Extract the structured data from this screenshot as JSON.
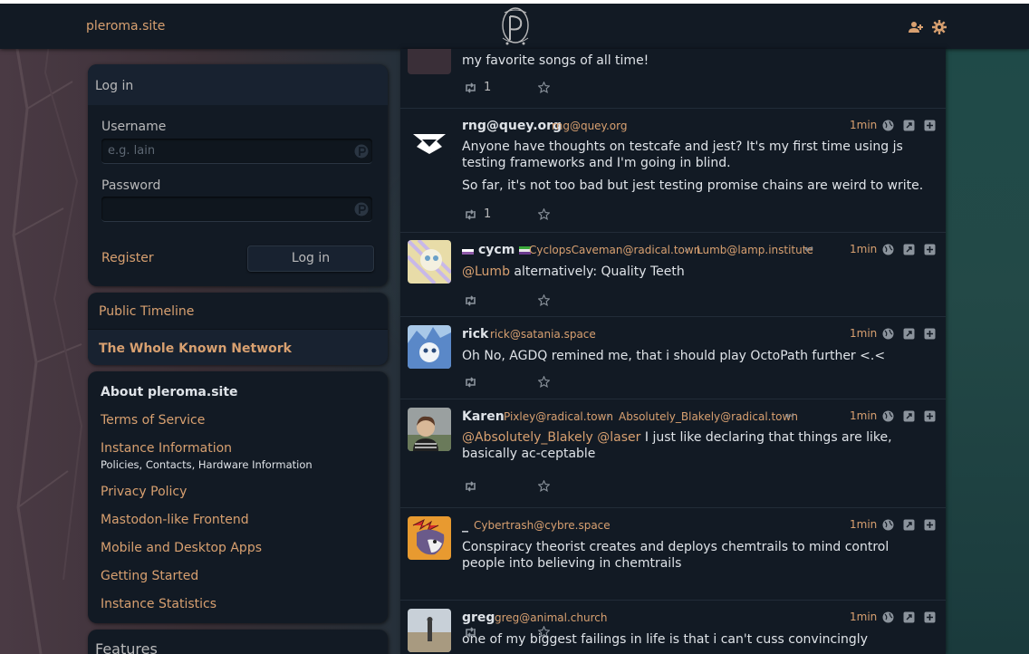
{
  "topbar": {
    "site_name": "pleroma.site",
    "logo_icon": "pleroma-logo",
    "icons": [
      "user-plus-icon",
      "gear-icon"
    ]
  },
  "colors": {
    "accent": "#d8a070",
    "panel": "#121a24",
    "text": "#b9b9ba",
    "link": "#d8a070"
  },
  "login": {
    "title": "Log in",
    "username_label": "Username",
    "username_placeholder": "e.g. lain",
    "password_label": "Password",
    "register_label": "Register",
    "login_button": "Log in"
  },
  "nav": {
    "items": [
      {
        "label": "Public Timeline"
      },
      {
        "label": "The Whole Known Network"
      }
    ]
  },
  "about": {
    "title": "About pleroma.site",
    "links": [
      {
        "label": "Terms of Service"
      },
      {
        "label": "Instance Information",
        "sub": "Policies, Contacts, Hardware Information"
      },
      {
        "label": "Privacy Policy"
      },
      {
        "label": "Mastodon-like Frontend"
      },
      {
        "label": "Mobile and Desktop Apps"
      },
      {
        "label": "Getting Started"
      },
      {
        "label": "Instance Statistics"
      }
    ]
  },
  "features": {
    "title": "Features"
  },
  "timeline": {
    "statuses": [
      {
        "content_tail": "my favorite songs of all time!",
        "retweets": "1"
      },
      {
        "name": "rng@quey.org",
        "handle": "rng@quey.org",
        "time": "1min",
        "content": [
          "Anyone have thoughts on testcafe and jest? It's my first time using js testing frameworks and I'm going in blind.",
          "So far, it's not too bad but jest testing promise chains are weird to write."
        ],
        "retweets": "1"
      },
      {
        "name": "cycm",
        "handle": "CyclopsCaveman@radical.town",
        "reply_to": "Lumb@lamp.institute",
        "time": "1min",
        "mention": "@Lumb",
        "content": " alternatively: Quality Teeth",
        "retweets": ""
      },
      {
        "name": "rick",
        "handle": "rick@satania.space",
        "time": "1min",
        "content": "Oh No, AGDQ remined me, that i should play OctoPath further <.<",
        "retweets": ""
      },
      {
        "name": "Karen",
        "handle": "Pixley@radical.town",
        "reply_to": "Absolutely_Blakely@radical.town",
        "time": "1min",
        "mention": "@Absolutely_Blakely @laser",
        "content": " I just like declaring that things are like, basically ac-ceptable",
        "retweets": ""
      },
      {
        "name": "_",
        "handle": "Cybertrash@cybre.space",
        "time": "1min",
        "content": "Conspiracy theorist creates and deploys chemtrails to mind control people into believing in chemtrails",
        "retweets": ""
      },
      {
        "name": "greg",
        "handle": "greg@animal.church",
        "time": "1min",
        "content": "one of my biggest failings in life is that i can't cuss convincingly",
        "retweets": ""
      }
    ]
  }
}
